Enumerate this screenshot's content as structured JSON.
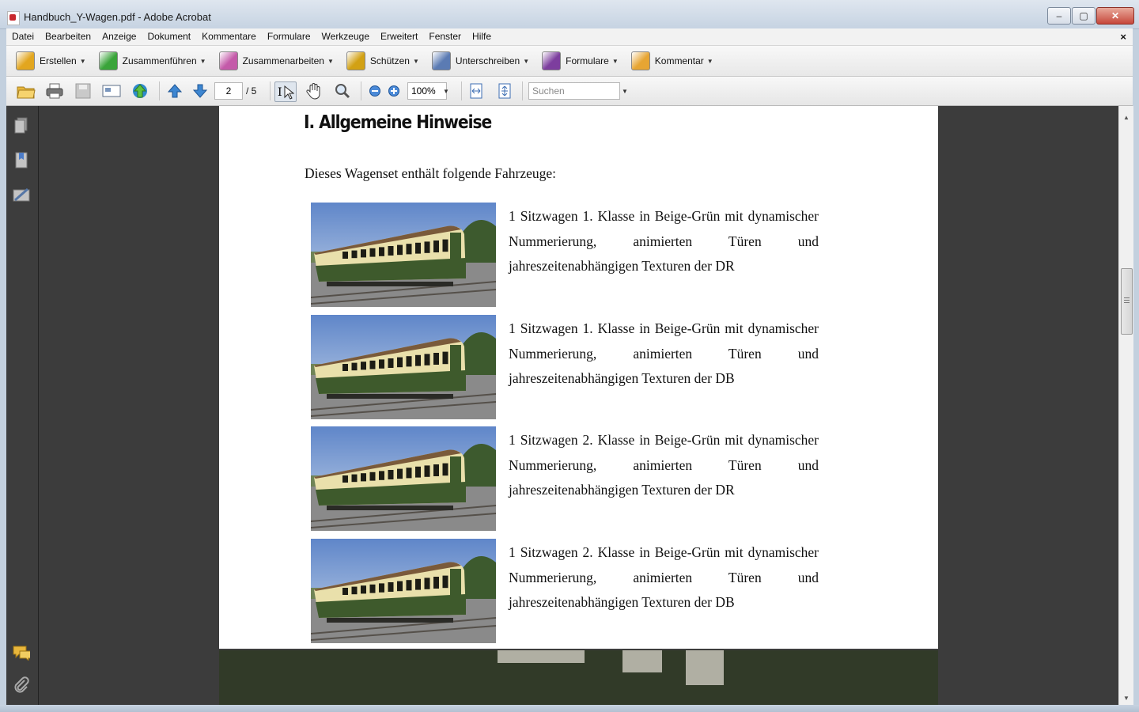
{
  "window": {
    "title": "Handbuch_Y-Wagen.pdf - Adobe Acrobat",
    "min": "–",
    "max": "▢",
    "close": "✕"
  },
  "menu": {
    "items": [
      "Datei",
      "Bearbeiten",
      "Anzeige",
      "Dokument",
      "Kommentare",
      "Formulare",
      "Werkzeuge",
      "Erweitert",
      "Fenster",
      "Hilfe"
    ],
    "close": "×"
  },
  "tasks": [
    {
      "label": "Erstellen",
      "icon": "create-pdf-icon",
      "color": "#e2a61f"
    },
    {
      "label": "Zusammenführen",
      "icon": "combine-icon",
      "color": "#3aa43a"
    },
    {
      "label": "Zusammenarbeiten",
      "icon": "collaborate-icon",
      "color": "#c45aa9"
    },
    {
      "label": "Schützen",
      "icon": "lock-icon",
      "color": "#d2a114"
    },
    {
      "label": "Unterschreiben",
      "icon": "pen-icon",
      "color": "#5b7bb3"
    },
    {
      "label": "Formulare",
      "icon": "forms-icon",
      "color": "#7d3e9e"
    },
    {
      "label": "Kommentar",
      "icon": "comment-icon",
      "color": "#e7a533"
    }
  ],
  "toolbar": {
    "page_current": "2",
    "page_total": "/ 5",
    "zoom": "100%",
    "search_placeholder": "Suchen"
  },
  "document": {
    "heading": "I. Allgemeine Hinweise",
    "intro": "Dieses Wagenset enthält folgende Fahrzeuge:",
    "entries": [
      {
        "text": "1 Sitzwagen 1. Klasse in Beige-Grün mit dynamischer Nummerierung, animierten Türen und jahreszeitenabhängigen Texturen der DR"
      },
      {
        "text": "1 Sitzwagen 1. Klasse in Beige-Grün mit dynamischer Nummerierung, animierten Türen und jahreszeitenabhängigen Texturen der DB"
      },
      {
        "text": "1 Sitzwagen 2. Klasse in Beige-Grün mit dynamischer Nummerierung, animierten Türen und jahreszeitenabhängigen Texturen der DR"
      },
      {
        "text": "1 Sitzwagen 2. Klasse in Beige-Grün mit dynamischer Nummerierung, animierten Türen und jahreszeitenabhängigen Texturen der DB"
      }
    ]
  },
  "colors": {
    "wagon_green": "#3e5a2c",
    "wagon_beige": "#e9e0ab",
    "wagon_roof": "#7a5a3a"
  }
}
